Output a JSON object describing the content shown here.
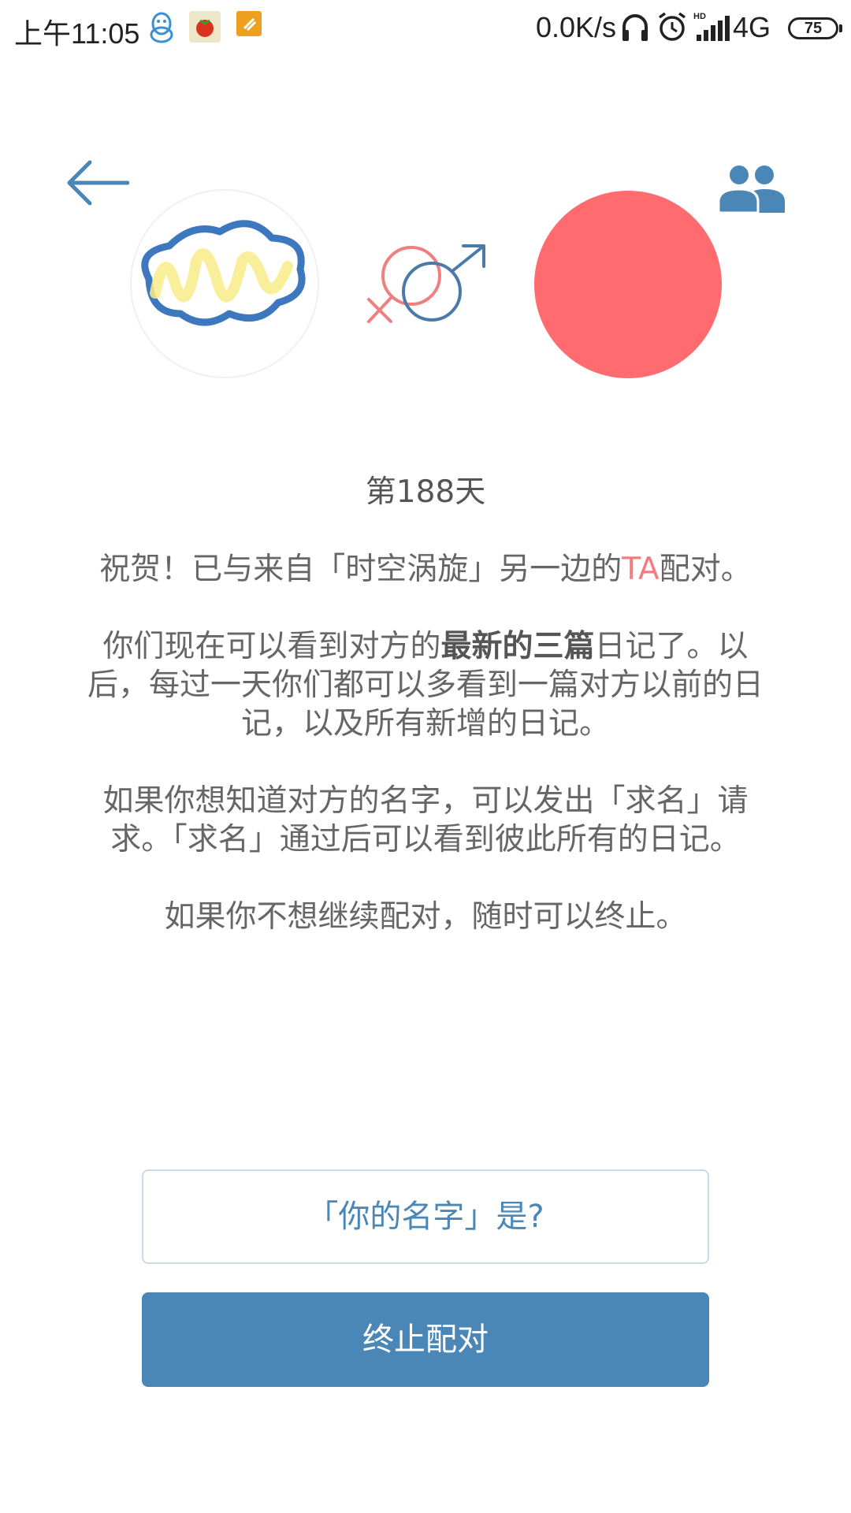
{
  "status_bar": {
    "time": "上午11:05",
    "network_speed": "0.0K/s",
    "network_type": "4G",
    "battery_level": "75",
    "icons": [
      "qq-icon",
      "tomato-app-icon",
      "clean-app-icon",
      "headphones-icon",
      "alarm-icon",
      "hd-signal-icon"
    ]
  },
  "header": {
    "back_icon": "arrow-left-icon",
    "friends_icon": "people-icon"
  },
  "pairing": {
    "my_avatar": "scribble-avatar",
    "gender_icon": "female-male-icon",
    "partner_avatar_color": "#ff6b6e"
  },
  "message": {
    "day_count": "第188天",
    "congrats_prefix": "祝贺！已与来自「时空涡旋」另一边的",
    "congrats_ta": "TA",
    "congrats_suffix": "配对。",
    "p2_prefix": "你们现在可以看到对方的",
    "p2_bold": "最新的三篇",
    "p2_suffix": "日记了。以后，每过一天你们都可以多看到一篇对方以前的日记，以及所有新增的日记。",
    "p3": "如果你想知道对方的名字，可以发出「求名」请求。「求名」通过后可以看到彼此所有的日记。",
    "p4": "如果你不想继续配对，随时可以终止。"
  },
  "actions": {
    "ask_name_label": "「你的名字」是?",
    "end_pair_label": "终止配对"
  },
  "colors": {
    "accent_blue": "#4a86b6",
    "partner_red": "#ff6b6e",
    "ta_pink": "#f27d80"
  }
}
